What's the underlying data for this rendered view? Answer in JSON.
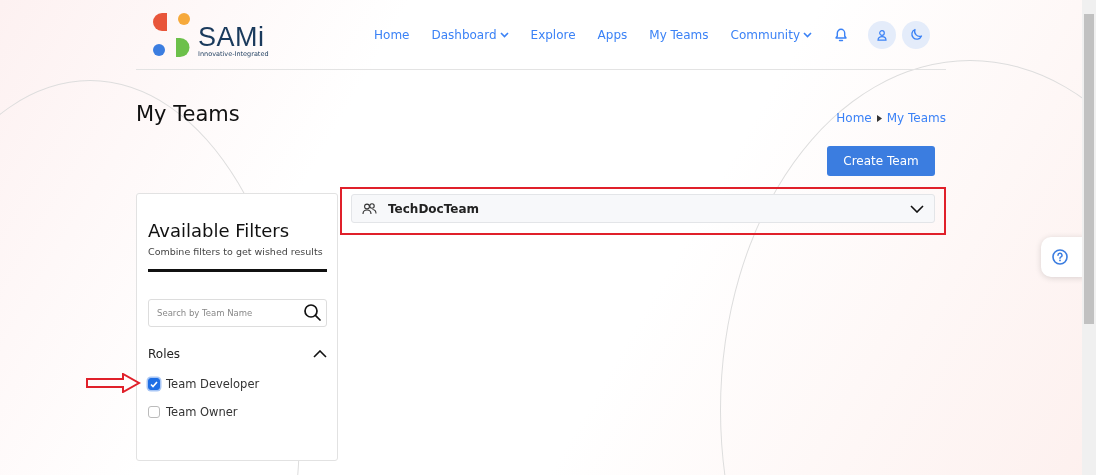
{
  "header": {
    "logo": {
      "name": "SAMi",
      "tagline": "Innovative-Integrated"
    },
    "nav": [
      {
        "label": "Home",
        "has_menu": false
      },
      {
        "label": "Dashboard",
        "has_menu": true
      },
      {
        "label": "Explore",
        "has_menu": false
      },
      {
        "label": "Apps",
        "has_menu": false
      },
      {
        "label": "My Teams",
        "has_menu": false
      },
      {
        "label": "Community",
        "has_menu": true
      }
    ]
  },
  "page": {
    "title": "My Teams",
    "breadcrumb": [
      "Home",
      "My Teams"
    ],
    "create_button": "Create Team"
  },
  "filters": {
    "title": "Available Filters",
    "subtitle": "Combine filters to get wished results",
    "search": {
      "placeholder": "Search by Team Name"
    },
    "sections": [
      {
        "title": "Roles",
        "expanded": true,
        "options": [
          {
            "label": "Team Developer",
            "checked": true
          },
          {
            "label": "Team Owner",
            "checked": false
          }
        ]
      }
    ]
  },
  "teams": [
    {
      "name": "TechDocTeam",
      "expanded": false
    }
  ]
}
